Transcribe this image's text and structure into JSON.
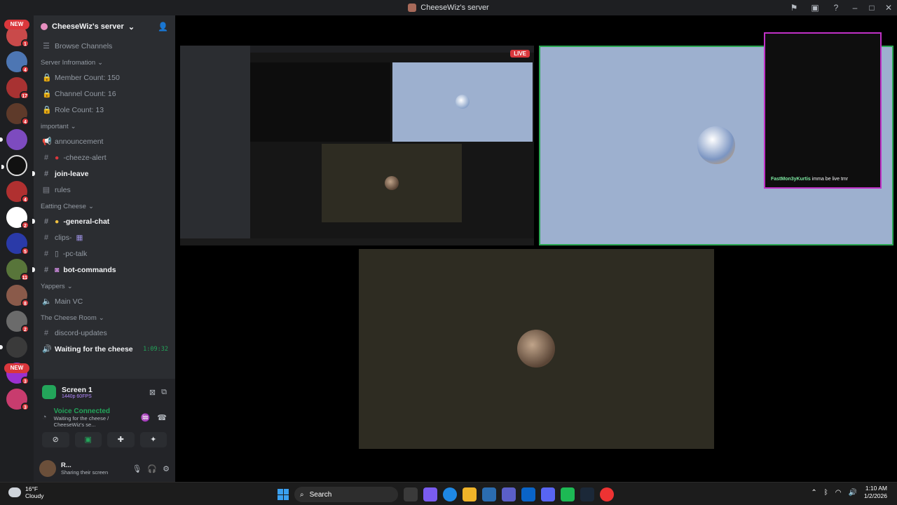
{
  "window": {
    "title": "CheeseWiz's server"
  },
  "guild_badges": [
    "1",
    "4",
    "17",
    "4",
    "",
    "",
    "4",
    "2",
    "5",
    "11",
    "8",
    "2",
    "",
    "3",
    "3",
    "",
    ""
  ],
  "new_label": "NEW",
  "sidebar": {
    "server_name": "CheeseWiz's server",
    "browse": "Browse Channels",
    "cat_info": "Server Infromation",
    "member_count": "Member Count: 150",
    "channel_count": "Channel Count: 16",
    "role_count": "Role Count: 13",
    "cat_important": "important",
    "announcement": "announcement",
    "cheeze_alert": "-cheeze-alert",
    "join_leave": "join-leave",
    "rules": "rules",
    "cat_eating": "Eatting Cheese",
    "general_chat": "-general-chat",
    "clips": "clips-",
    "pc_talk": "-pc-talk",
    "bot_commands": "bot-commands",
    "cat_yappers": "Yappers",
    "main_vc": "Main VC",
    "cat_room": "The Cheese Room",
    "discord_updates": "discord-updates",
    "waiting": "Waiting for the cheese",
    "timer": "1:09:32"
  },
  "panel": {
    "screen_title": "Screen 1",
    "screen_quality": "1440p 60FPS",
    "voice_status": "Voice Connected",
    "voice_channel": "Waiting for the cheese / CheeseWiz's se...",
    "username": "R...",
    "user_status": "Sharing their screen"
  },
  "stage": {
    "live_label": "LIVE",
    "chat_name": "FastMon3yKurtis",
    "chat_msg": "imma be live tmr"
  },
  "taskbar": {
    "temp": "16°F",
    "weather": "Cloudy",
    "search": "Search",
    "time": "1:10 AM",
    "date": "1/2/2026"
  },
  "colors": {
    "accent_green": "#23a55a",
    "badge_red": "#da373c",
    "popout_border": "#c031c7"
  }
}
